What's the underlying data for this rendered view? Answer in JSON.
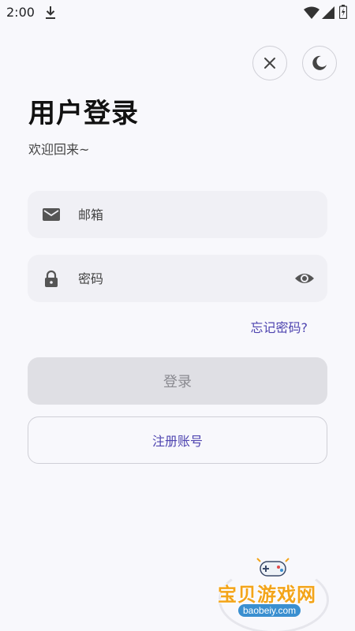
{
  "status_bar": {
    "time": "2:00",
    "icons": [
      "download-icon",
      "wifi-icon",
      "signal-icon",
      "battery-icon"
    ]
  },
  "toolbar": {
    "close_icon": "close-icon",
    "theme_icon": "moon-icon"
  },
  "header": {
    "title": "用户登录",
    "subtitle": "欢迎回来~"
  },
  "form": {
    "email_placeholder": "邮箱",
    "email_value": "",
    "password_placeholder": "密码",
    "password_value": "",
    "forgot_label": "忘记密码?",
    "login_label": "登录",
    "register_label": "注册账号"
  },
  "watermark": {
    "name": "宝贝游戏网",
    "url": "baobeiy.com"
  },
  "colors": {
    "accent": "#4f45b0",
    "field_bg": "#f0f0f5",
    "disabled_button": "#dfdfe4",
    "background": "#f8f8fc",
    "watermark_orange": "#f3a419"
  }
}
